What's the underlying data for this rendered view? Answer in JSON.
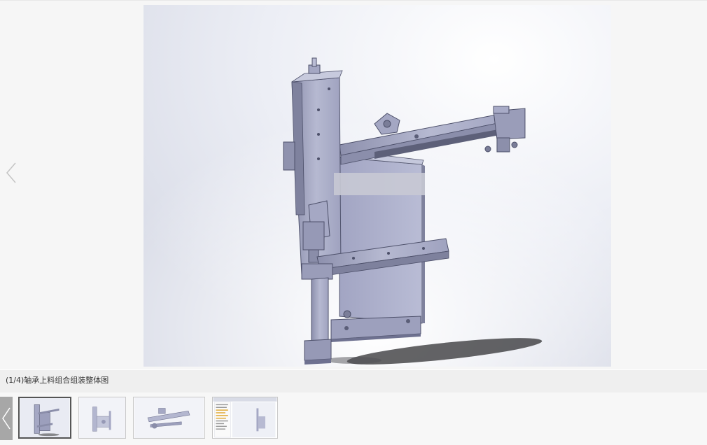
{
  "viewer": {
    "caption": "(1/4)轴承上料组合组装整体图",
    "prev_icon": "chevron-left-icon"
  },
  "thumbnails": [
    {
      "label": "thumb-1",
      "active": true
    },
    {
      "label": "thumb-2",
      "active": false
    },
    {
      "label": "thumb-3",
      "active": false
    },
    {
      "label": "thumb-4",
      "active": false
    }
  ],
  "colors": {
    "metal": "#a9acc6",
    "metal_dark": "#6f7290",
    "caption_bg": "#efefef",
    "active_border": "#555555"
  }
}
